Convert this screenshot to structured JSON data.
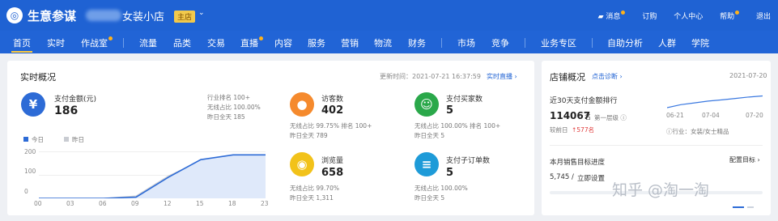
{
  "header": {
    "brand": "生意参谋",
    "shop_name": "女装小店",
    "shop_tag": "主店",
    "chevron": "⌄",
    "links": [
      "消息",
      "订购",
      "个人中心",
      "帮助",
      "退出"
    ]
  },
  "nav": {
    "items": [
      "首页",
      "实时",
      "作战室",
      "流量",
      "品类",
      "交易",
      "直播",
      "内容",
      "服务",
      "营销",
      "物流",
      "财务",
      "市场",
      "竞争",
      "业务专区",
      "自助分析",
      "人群",
      "学院"
    ]
  },
  "realtime": {
    "title": "实时概况",
    "update_label": "更新时间：2021-07-21 16:37:59",
    "live_link": "实时直播 ›",
    "pay_amount": {
      "label": "支付金额(元)",
      "value": "186"
    },
    "industry_rank": "行业排名  100+",
    "wireless_ratio": "无线占比  100.00%",
    "yesterday": "昨日全天  185",
    "legend": [
      "今日",
      "昨日"
    ],
    "yaxis": [
      "200",
      "100",
      "0"
    ],
    "xaxis": [
      "00",
      "03",
      "06",
      "09",
      "12",
      "15",
      "18",
      "23"
    ],
    "metrics": [
      {
        "name": "访客数",
        "value": "402",
        "line1": "无线占比  99.75%    排名 100+",
        "line2": "昨日全天  789"
      },
      {
        "name": "支付买家数",
        "value": "5",
        "line1": "无线占比  100.00%   排名 100+",
        "line2": "昨日全天  5"
      },
      {
        "name": "浏览量",
        "value": "658",
        "line1": "无线占比  99.70%",
        "line2": "昨日全天  1,311"
      },
      {
        "name": "支付子订单数",
        "value": "5",
        "line1": "无线占比  100.00%",
        "line2": "昨日全天  5"
      }
    ]
  },
  "shop": {
    "title": "店铺概况",
    "diag_link": "点击诊断 ›",
    "date": "2021-07-20",
    "rank_title": "近30天支付金额排行",
    "rank_value": "114067",
    "rank_suffix": "名",
    "tier": "第一层级 ⓘ",
    "compare_label": "较前日",
    "compare_value": "↑577名",
    "industry": "ⓘ行业：女装/女士精品",
    "mini_x": [
      "06-21",
      "07-04",
      "07-20"
    ],
    "target_title": "本月销售目标进度",
    "target_link": "配置目标 ›",
    "progress": "5,745 /",
    "set_link": "立即设置"
  },
  "watermark": "知乎 @淘一淘",
  "chart_data": [
    {
      "type": "line",
      "title": "",
      "xlabel": "",
      "ylabel": "",
      "ylim": [
        0,
        200
      ],
      "x": [
        "00",
        "03",
        "06",
        "09",
        "12",
        "15",
        "18",
        "23"
      ],
      "series": [
        {
          "name": "今日",
          "values": [
            0,
            0,
            0,
            5,
            90,
            165,
            185,
            185
          ],
          "color": "#2d6bd6"
        },
        {
          "name": "昨日",
          "values": [
            0,
            0,
            0,
            10,
            95,
            160,
            180,
            185
          ],
          "color": "#c9ccd2"
        }
      ]
    },
    {
      "type": "line",
      "title": "",
      "ylim": [
        0,
        1
      ],
      "x": [
        "06-21",
        "07-04",
        "07-20"
      ],
      "series": [
        {
          "name": "",
          "values": [
            0.18,
            0.35,
            0.45,
            0.55,
            0.62,
            0.7,
            0.78,
            0.84
          ],
          "color": "#3a78e0"
        }
      ]
    }
  ]
}
